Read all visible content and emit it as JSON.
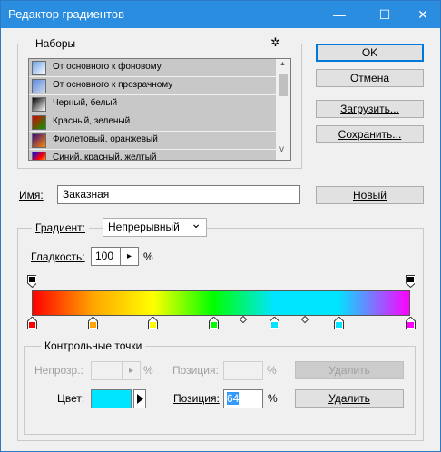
{
  "window": {
    "title": "Редактор градиентов",
    "minimize": "—",
    "maximize": "☐",
    "close": "✕"
  },
  "presets": {
    "group_label": "Наборы",
    "gear": "✲",
    "items": [
      {
        "label": "От основного к фоновому",
        "swatch": "linear-gradient(135deg,#6aa0e8,#ffffff)"
      },
      {
        "label": "От основного к прозрачному",
        "swatch": "linear-gradient(135deg,#5b8be0,#cfd8ea)"
      },
      {
        "label": "Черный, белый",
        "swatch": "linear-gradient(135deg,#000000,#ffffff)"
      },
      {
        "label": "Красный, зеленый",
        "swatch": "linear-gradient(135deg,#e00000,#00a000)"
      },
      {
        "label": "Фиолетовый, оранжевый",
        "swatch": "linear-gradient(135deg,#3a0a80,#ff8a00)"
      },
      {
        "label": "Синий, красный, желтый",
        "swatch": "linear-gradient(135deg,#0000ff,#ff0000,#ffff00)"
      }
    ],
    "scroll_up": "▲",
    "scroll_down": "v"
  },
  "buttons": {
    "ok": "OK",
    "cancel": "Отмена",
    "load": "Загрузить...",
    "save": "Сохранить...",
    "new": "Новый",
    "delete_disabled": "Удалить",
    "delete": "Удалить"
  },
  "name": {
    "label": "Имя:",
    "value": "Заказная"
  },
  "gradient": {
    "type_label": "Градиент:",
    "type_value": "Непрерывный",
    "smoothness_label": "Гладкость:",
    "smoothness_value": "100",
    "smoothness_unit": "%",
    "stepper_arrow": "▸",
    "dropdown_arrow": "⌄"
  },
  "gradient_bar": {
    "colors": [
      "#ff0000",
      "#ffa500",
      "#ffff00",
      "#00ff00",
      "#00e5ff",
      "#2020ff",
      "#ff00ff"
    ],
    "color_stops": [
      {
        "color": "#ff0000",
        "position": 0
      },
      {
        "color": "#ffa500",
        "position": 16
      },
      {
        "color": "#ffff00",
        "position": 32
      },
      {
        "color": "#00ff00",
        "position": 48
      },
      {
        "color": "#00e5ff",
        "position": 64
      },
      {
        "color": "#00e5ff",
        "position": 81
      },
      {
        "color": "#ff00ff",
        "position": 100
      }
    ],
    "opacity_stops": [
      {
        "color": "#000000",
        "position": 0
      },
      {
        "color": "#000000",
        "position": 100
      }
    ]
  },
  "stops": {
    "group_label": "Контрольные точки",
    "opacity_label": "Непрозр.:",
    "opacity_unit": "%",
    "position_label_disabled": "Позиция:",
    "position_unit_disabled": "%",
    "color_label": "Цвет:",
    "color_value": "#00e5ff",
    "position_label": "Позиция:",
    "position_value": "64",
    "position_unit": "%"
  }
}
